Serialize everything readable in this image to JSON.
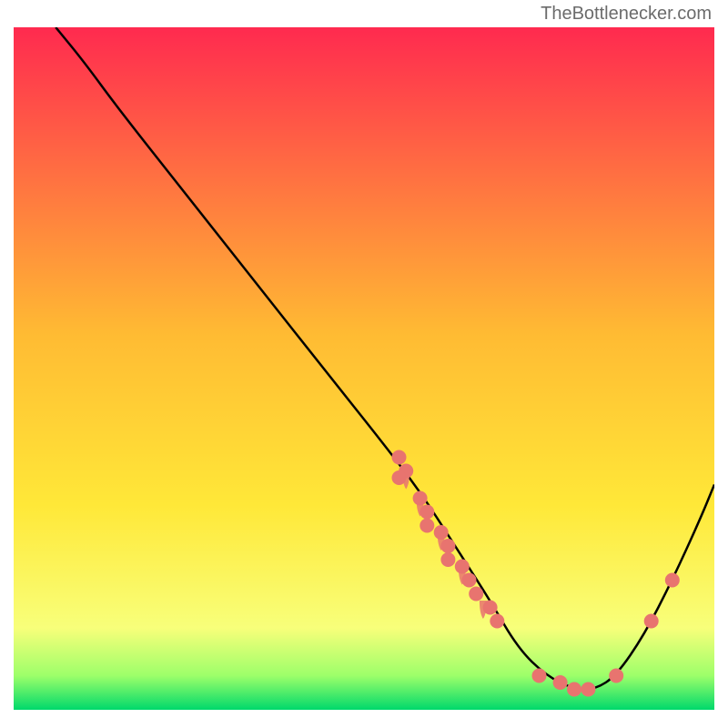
{
  "watermark": "TheBottlenecker.com",
  "chart_data": {
    "type": "line",
    "title": "",
    "xlabel": "",
    "ylabel": "",
    "xlim": [
      0,
      100
    ],
    "ylim": [
      0,
      100
    ],
    "gradient_stops": [
      {
        "offset": 0,
        "color": "#ff2a4f"
      },
      {
        "offset": 45,
        "color": "#ffbb33"
      },
      {
        "offset": 70,
        "color": "#ffe838"
      },
      {
        "offset": 88,
        "color": "#f8ff7a"
      },
      {
        "offset": 95,
        "color": "#9dff6a"
      },
      {
        "offset": 100,
        "color": "#00d96b"
      }
    ],
    "curve_points": [
      {
        "x": 6,
        "y": 100
      },
      {
        "x": 10,
        "y": 95
      },
      {
        "x": 15,
        "y": 88
      },
      {
        "x": 25,
        "y": 75
      },
      {
        "x": 35,
        "y": 62
      },
      {
        "x": 45,
        "y": 49
      },
      {
        "x": 52,
        "y": 40
      },
      {
        "x": 58,
        "y": 32
      },
      {
        "x": 63,
        "y": 24
      },
      {
        "x": 68,
        "y": 16
      },
      {
        "x": 72,
        "y": 9
      },
      {
        "x": 76,
        "y": 5
      },
      {
        "x": 80,
        "y": 3
      },
      {
        "x": 83,
        "y": 3
      },
      {
        "x": 86,
        "y": 5
      },
      {
        "x": 90,
        "y": 11
      },
      {
        "x": 94,
        "y": 19
      },
      {
        "x": 98,
        "y": 28
      },
      {
        "x": 100,
        "y": 33
      }
    ],
    "scatter_points": [
      {
        "x": 55,
        "y": 37
      },
      {
        "x": 56,
        "y": 35
      },
      {
        "x": 55,
        "y": 34
      },
      {
        "x": 58,
        "y": 31
      },
      {
        "x": 59,
        "y": 29
      },
      {
        "x": 59,
        "y": 27
      },
      {
        "x": 61,
        "y": 26
      },
      {
        "x": 62,
        "y": 24
      },
      {
        "x": 62,
        "y": 22
      },
      {
        "x": 64,
        "y": 21
      },
      {
        "x": 65,
        "y": 19
      },
      {
        "x": 66,
        "y": 17
      },
      {
        "x": 68,
        "y": 15
      },
      {
        "x": 69,
        "y": 13
      },
      {
        "x": 75,
        "y": 5
      },
      {
        "x": 78,
        "y": 4
      },
      {
        "x": 80,
        "y": 3
      },
      {
        "x": 82,
        "y": 3
      },
      {
        "x": 86,
        "y": 5
      },
      {
        "x": 91,
        "y": 13
      },
      {
        "x": 94,
        "y": 19
      }
    ],
    "drip_markers": [
      {
        "x": 56,
        "y": 35
      },
      {
        "x": 58,
        "y": 31
      },
      {
        "x": 61,
        "y": 26
      },
      {
        "x": 64,
        "y": 21
      },
      {
        "x": 67,
        "y": 16
      }
    ]
  }
}
